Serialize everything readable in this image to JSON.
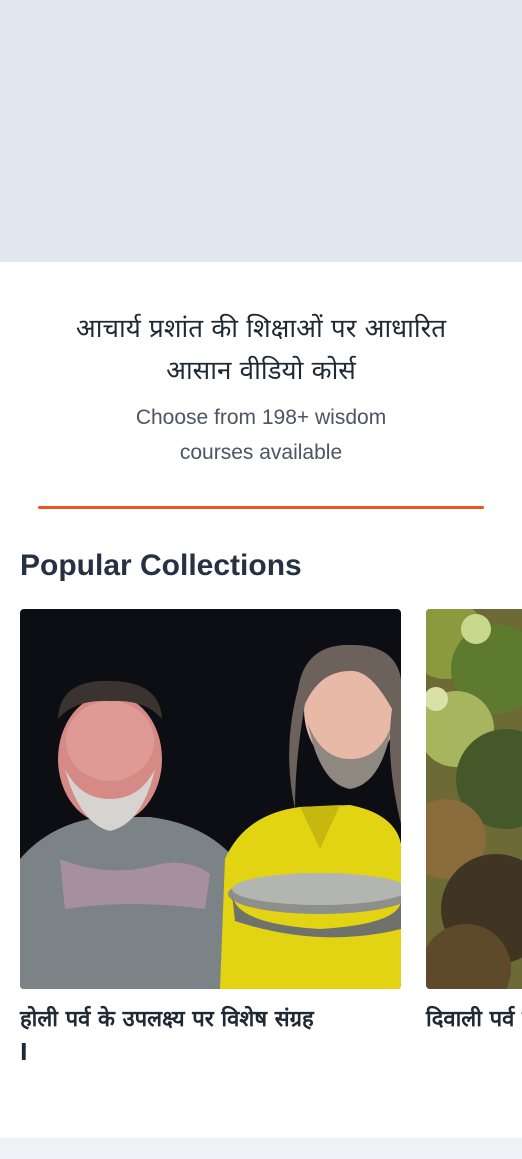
{
  "intro": {
    "heading_line1": "आचार्य प्रशांत की शिक्षाओं पर आधारित",
    "heading_line2": "आसान वीडियो कोर्स",
    "sub_line1": "Choose from 198+ wisdom",
    "sub_line2": "courses available"
  },
  "section": {
    "title": "Popular Collections"
  },
  "collections": [
    {
      "title": "होली पर्व के उपलक्ष्य पर विशेष संग्रह l"
    },
    {
      "title": "दिवाली पर्व संग्रह"
    }
  ],
  "colors": {
    "hero_bg": "#e2e8f0",
    "accent": "#e8551f",
    "title_text": "#263244"
  }
}
